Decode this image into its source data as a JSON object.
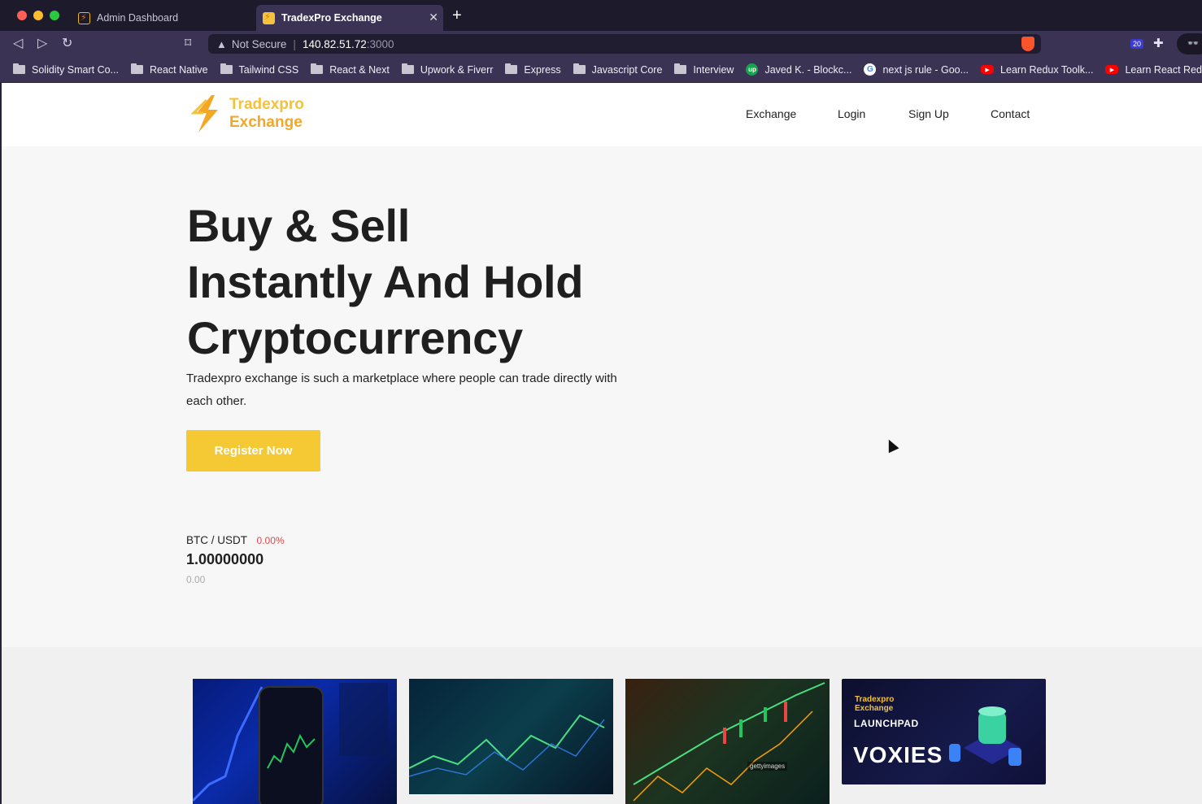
{
  "browser": {
    "tabs": [
      {
        "label": "Admin Dashboard",
        "active": false
      },
      {
        "label": "TradexPro Exchange",
        "active": true
      }
    ],
    "address": {
      "warning": "Not Secure",
      "host": "140.82.51.72",
      "port": ":3000"
    },
    "extension_badge": "20",
    "bookmarks": [
      {
        "label": "Solidity Smart Co...",
        "icon": "folder-icon"
      },
      {
        "label": "React Native",
        "icon": "folder-icon"
      },
      {
        "label": "Tailwind CSS",
        "icon": "folder-icon"
      },
      {
        "label": "React & Next",
        "icon": "folder-icon"
      },
      {
        "label": "Upwork & Fiverr",
        "icon": "folder-icon"
      },
      {
        "label": "Express",
        "icon": "folder-icon"
      },
      {
        "label": "Javascript Core",
        "icon": "folder-icon"
      },
      {
        "label": "Interview",
        "icon": "folder-icon"
      },
      {
        "label": "Javed K. - Blockc...",
        "icon": "upwork-icon"
      },
      {
        "label": "next js rule - Goo...",
        "icon": "google-icon"
      },
      {
        "label": "Learn Redux Toolk...",
        "icon": "youtube-icon"
      },
      {
        "label": "Learn React Redu...",
        "icon": "youtube-icon"
      }
    ]
  },
  "site": {
    "logo": {
      "line1": "Tradexpro",
      "line2": "Exchange"
    },
    "nav": [
      "Exchange",
      "Login",
      "Sign Up",
      "Contact"
    ],
    "hero": {
      "title_line1": "Buy & Sell",
      "title_line2": "Instantly And Hold",
      "title_line3": "Cryptocurrency",
      "description": "Tradexpro exchange is such a marketplace where people can trade directly with each other.",
      "cta": "Register Now"
    },
    "ticker": {
      "pair": "BTC / USDT",
      "change": "0.00%",
      "price": "1.00000000",
      "volume": "0.00"
    },
    "cards": {
      "card4_logo_line1": "Tradexpro",
      "card4_logo_line2": "Exchange",
      "card4_tag": "LAUNCHPAD",
      "card4_title": "VOXIES",
      "card3_watermark": "gettyimages"
    }
  },
  "colors": {
    "accent": "#f5c934",
    "negative": "#e0484f",
    "browser_chrome": "#3a3353"
  }
}
